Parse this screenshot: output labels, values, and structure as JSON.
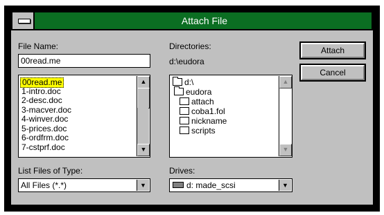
{
  "window": {
    "title": "Attach File"
  },
  "labels": {
    "file_name": "File Name:",
    "directories": "Directories:",
    "current_directory": "d:\\eudora",
    "list_files_of_type": "List Files of Type:",
    "drives": "Drives:"
  },
  "file_name_value": "00read.me",
  "files": [
    "00read.me",
    "1-intro.doc",
    "2-desc.doc",
    "3-macver.doc",
    "4-winver.doc",
    "5-prices.doc",
    "6-ordfrm.doc",
    "7-cstprf.doc"
  ],
  "directories": [
    {
      "name": "d:\\",
      "icon": "open-folder-icon"
    },
    {
      "name": "eudora",
      "icon": "open-folder-icon"
    },
    {
      "name": "attach",
      "icon": "folder-icon"
    },
    {
      "name": "coba1.fol",
      "icon": "folder-icon"
    },
    {
      "name": "nickname",
      "icon": "folder-icon"
    },
    {
      "name": "scripts",
      "icon": "folder-icon"
    }
  ],
  "file_type_value": "All Files (*.*)",
  "drive_value": "d: made_scsi",
  "buttons": {
    "attach": "Attach",
    "cancel": "Cancel"
  },
  "colors": {
    "title_bar": "#0b6e22",
    "dialog_face": "#c0c0c0",
    "selection": "#ffff00"
  }
}
